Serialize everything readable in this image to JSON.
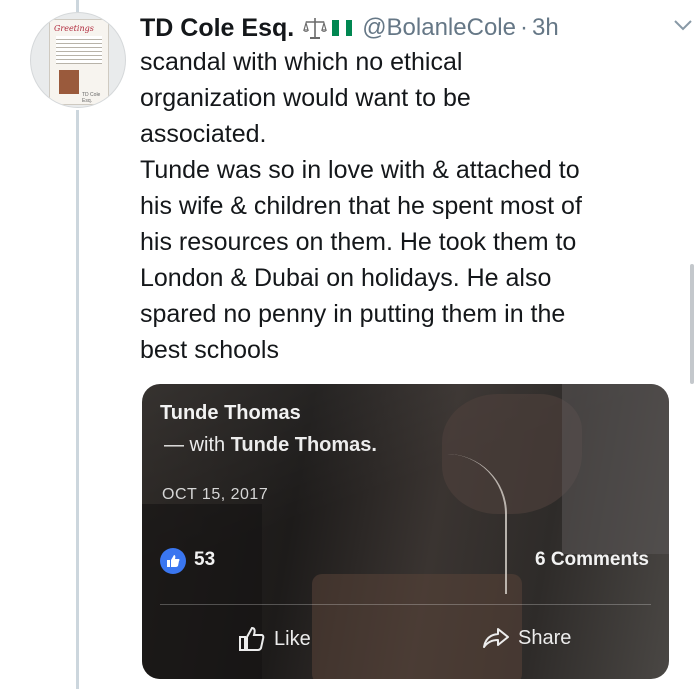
{
  "tweet": {
    "display_name": "TD Cole Esq.",
    "handle": "@BolanleCole",
    "separator": "·",
    "time": "3h",
    "text": "scandal with which no ethical\norganization would want to be\nassociated.\nTunde was so in love with & attached to\nhis wife & children that he spent most of\nhis resources on them. He took them to\nLondon & Dubai on holidays. He also\nspared no penny in putting them in the\nbest schools",
    "avatar_text": {
      "greeting": "Greetings",
      "signature": "TD Cole Esq."
    },
    "icons": {
      "badge": "scales-of-justice-icon",
      "flag": "nigeria-flag-icon",
      "menu": "chevron-down-icon"
    }
  },
  "embedded_post": {
    "author": "Tunde Thomas",
    "with_prefix": "— with",
    "with_name": "Tunde Thomas.",
    "date": "OCT 15, 2017",
    "like_count": "53",
    "comments": "6 Comments",
    "like_label": "Like",
    "share_label": "Share"
  },
  "colors": {
    "handle_gray": "#657786",
    "flag_green": "#008751",
    "fb_blue": "#3a76f0"
  }
}
